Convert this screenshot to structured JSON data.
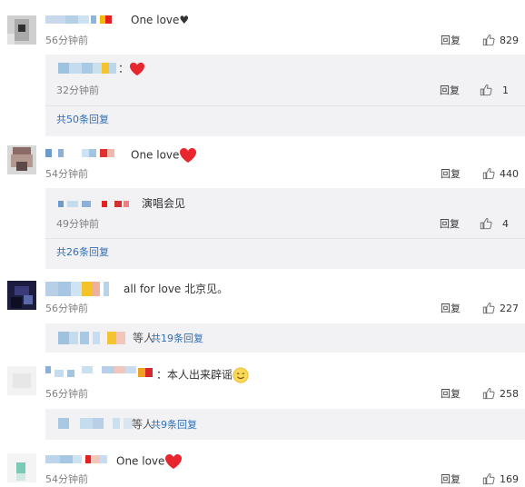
{
  "comments": [
    {
      "text": "One love♥",
      "time": "56分钟前",
      "reply": "回复",
      "likes": "829",
      "sub_reply": {
        "text": "：",
        "time": "32分钟前",
        "reply": "回复",
        "likes": "1"
      },
      "more": "共50条回复"
    },
    {
      "text": "One love",
      "time": "54分钟前",
      "reply": "回复",
      "likes": "440",
      "sub_reply": {
        "text": "演唱会见",
        "time": "49分钟前",
        "reply": "回复",
        "likes": "4"
      },
      "more": "共26条回复"
    },
    {
      "text": "all for love 北京见。",
      "time": "56分钟前",
      "reply": "回复",
      "likes": "227",
      "partial_prefix": "等人",
      "more": "共19条回复"
    },
    {
      "text": "：本人出来辟谣",
      "time": "56分钟前",
      "reply": "回复",
      "likes": "258",
      "partial_prefix": "等人",
      "more": "共9条回复"
    },
    {
      "text": "One love",
      "time": "54分钟前",
      "reply": "回复",
      "likes": "169"
    }
  ],
  "icons": {
    "like": "thumbs-up-icon",
    "heart": "red-heart-emoji",
    "smile": "smiley-emoji"
  },
  "colors": {
    "link": "#2f6fb7",
    "meta": "#808080",
    "sub_bg": "#f2f2f5",
    "heart": "#e8262e"
  }
}
